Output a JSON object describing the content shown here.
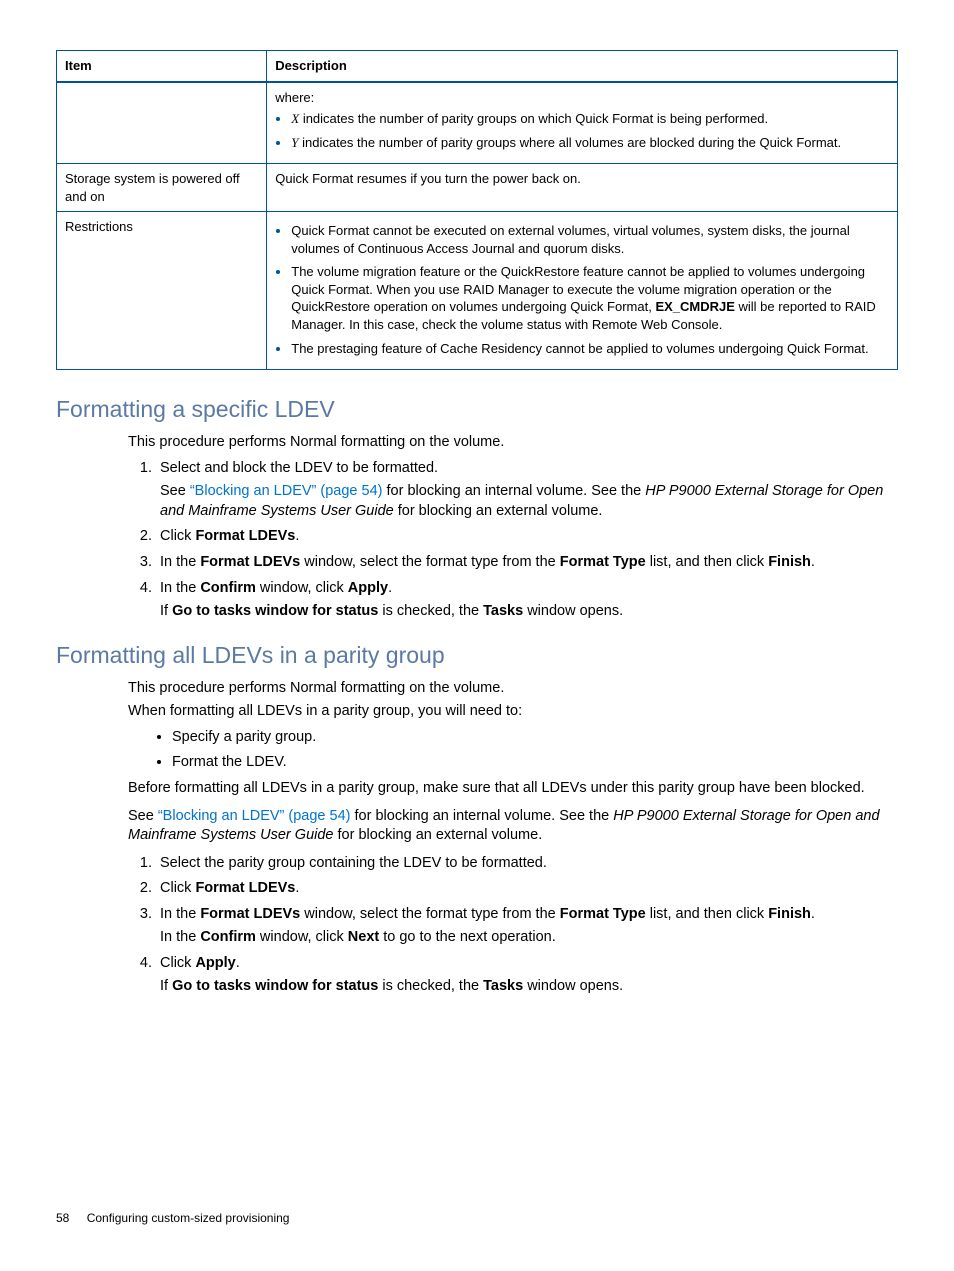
{
  "table": {
    "headers": {
      "item": "Item",
      "desc": "Description"
    },
    "row1": {
      "desc_where": "where:",
      "b1_var": "X",
      "b1_txt": " indicates the number of parity groups on which Quick Format is being performed.",
      "b2_var": "Y",
      "b2_txt": " indicates the number of parity groups where all volumes are blocked during the Quick Format."
    },
    "row2": {
      "item": "Storage system is powered off and on",
      "desc": "Quick Format resumes if you turn the power back on."
    },
    "row3": {
      "item": "Restrictions",
      "b1": "Quick Format cannot be executed on external volumes, virtual volumes, system disks, the journal volumes of Continuous Access Journal and quorum disks.",
      "b2_pre": "The volume migration feature or the QuickRestore feature cannot be applied to volumes undergoing Quick Format. When you use RAID Manager to execute the volume migration operation or the QuickRestore operation on volumes undergoing Quick Format, ",
      "b2_bold": "EX_CMDRJE",
      "b2_post": " will be reported to RAID Manager. In this case, check the volume status with Remote Web Console.",
      "b3": "The prestaging feature of Cache Residency cannot be applied to volumes undergoing Quick Format."
    }
  },
  "sec1": {
    "title": "Formatting a specific LDEV",
    "intro": "This procedure performs Normal formatting on the volume.",
    "s1": "Select and block the LDEV to be formatted.",
    "s1b_pre": "See ",
    "s1b_link": "“Blocking an LDEV” (page 54)",
    "s1b_mid": " for blocking an internal volume. See the ",
    "s1b_ital": "HP P9000 External Storage for Open and Mainframe Systems User Guide",
    "s1b_post": " for blocking an external volume.",
    "s2_pre": "Click ",
    "s2_bold": "Format LDEVs",
    "s2_post": ".",
    "s3_a": "In the ",
    "s3_b1": "Format LDEVs",
    "s3_b": " window, select the format type from the ",
    "s3_b2": "Format Type",
    "s3_c": " list, and then click ",
    "s3_b3": "Finish",
    "s3_d": ".",
    "s4_a": "In the ",
    "s4_b1": "Confirm",
    "s4_b": " window, click ",
    "s4_b2": "Apply",
    "s4_c": ".",
    "s4n_a": "If ",
    "s4n_b1": "Go to tasks window for status",
    "s4n_b": " is checked, the ",
    "s4n_b2": "Tasks",
    "s4n_c": " window opens."
  },
  "sec2": {
    "title": "Formatting all LDEVs in a parity group",
    "intro": "This procedure performs Normal formatting on the volume.",
    "need": "When formatting all LDEVs in a parity group, you will need to:",
    "bul1": "Specify a parity group.",
    "bul2": "Format the LDEV.",
    "before": "Before formatting all LDEVs in a parity group, make sure that all LDEVs under this parity group have been blocked.",
    "see_pre": "See ",
    "see_link": "“Blocking an LDEV” (page 54)",
    "see_mid": " for blocking an internal volume. See the ",
    "see_ital": "HP P9000 External Storage for Open and Mainframe Systems User Guide",
    "see_post": " for blocking an external volume.",
    "s1": "Select the parity group containing the LDEV to be formatted.",
    "s2_pre": "Click ",
    "s2_bold": "Format LDEVs",
    "s2_post": ".",
    "s3_a": "In the ",
    "s3_b1": "Format LDEVs",
    "s3_b": " window, select the format type from the ",
    "s3_b2": "Format Type",
    "s3_c": " list, and then click ",
    "s3_b3": "Finish",
    "s3_d": ".",
    "s3n_a": "In the ",
    "s3n_b1": "Confirm",
    "s3n_b": " window, click ",
    "s3n_b2": "Next",
    "s3n_c": " to go to the next operation.",
    "s4_pre": "Click ",
    "s4_bold": "Apply",
    "s4_post": ".",
    "s4n_a": "If ",
    "s4n_b1": "Go to tasks window for status",
    "s4n_b": " is checked, the ",
    "s4n_b2": "Tasks",
    "s4n_c": " window opens."
  },
  "footer": {
    "page": "58",
    "title": "Configuring custom-sized provisioning"
  }
}
